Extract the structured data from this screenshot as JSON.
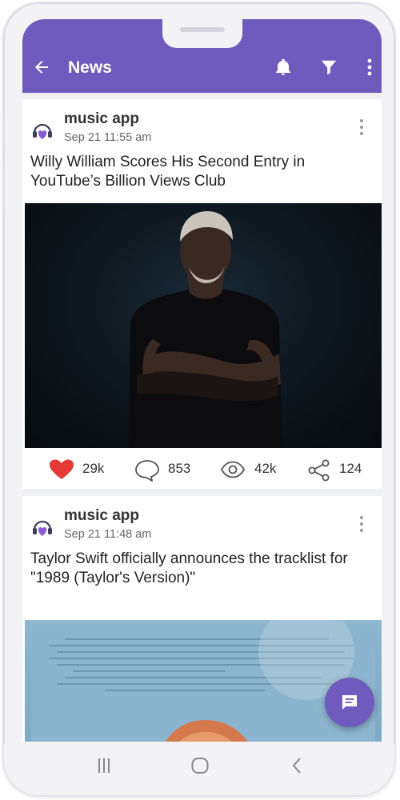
{
  "appbar": {
    "title": "News",
    "back_icon": "arrow-left-icon",
    "actions": [
      "bell-icon",
      "filter-icon",
      "more-vertical-icon"
    ],
    "color": "#6e5bbd"
  },
  "posts": [
    {
      "source": "music app",
      "date": "Sep 21 11:55 am",
      "headline": "Willy William Scores His Second Entry in YouTube’s Billion Views Club",
      "stats": {
        "likes": "29k",
        "comments": "853",
        "views": "42k",
        "shares": "124"
      }
    },
    {
      "source": "music app",
      "date": "Sep 21 11:48 am",
      "headline": "Taylor Swift officially announces the tracklist for \"1989 (Taylor's Version)\""
    }
  ],
  "fab": {
    "icon": "chat-icon"
  },
  "system_nav": [
    "recents-icon",
    "home-icon",
    "back-icon"
  ]
}
